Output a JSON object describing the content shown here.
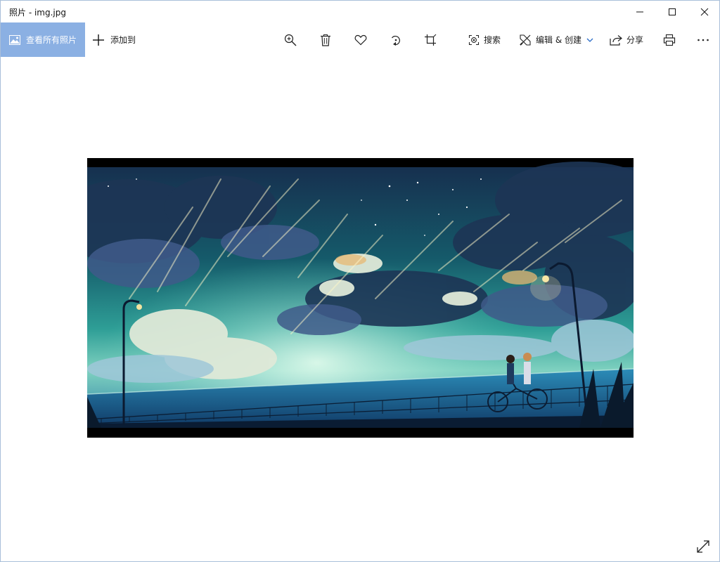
{
  "window": {
    "title": "照片 - img.jpg"
  },
  "toolbar": {
    "view_all_label": "查看所有照片",
    "add_to_label": "添加到",
    "search_label": "搜索",
    "edit_create_label": "编辑 & 创建",
    "share_label": "分享",
    "icons": [
      "zoom-in-icon",
      "delete-icon",
      "heart-icon",
      "rotate-icon",
      "crop-icon",
      "search-lens-icon",
      "edit-icon",
      "chevron-down-icon",
      "share-icon",
      "print-icon",
      "more-icon"
    ]
  },
  "colors": {
    "accent": "#8bb0e3",
    "titlebar": "#ffffff",
    "sky_top": "#0f2a44",
    "sky_glow": "#2fb2a5",
    "sea": "#1b5f8e"
  }
}
